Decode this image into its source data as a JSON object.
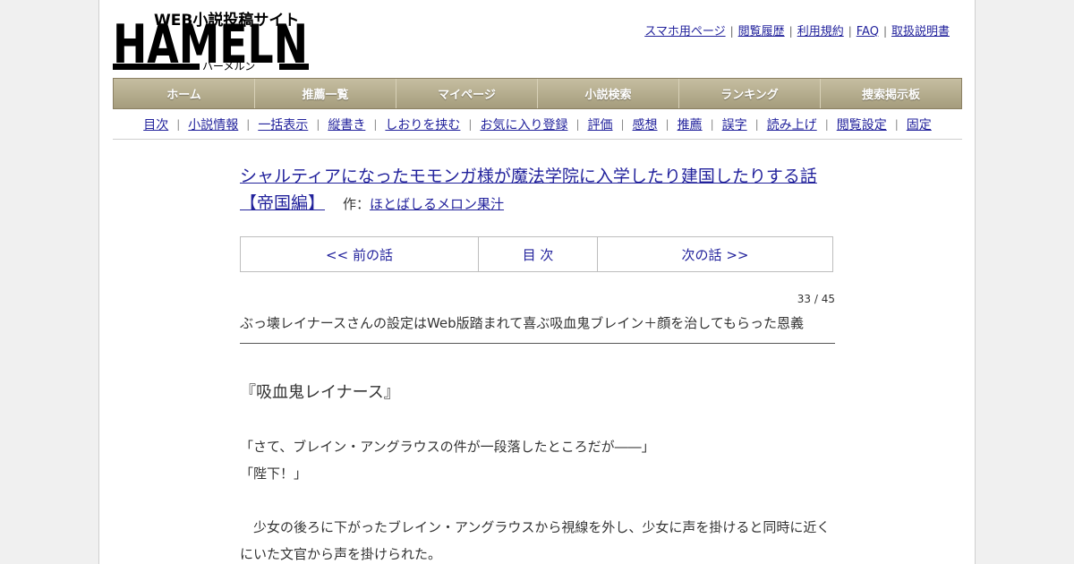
{
  "logo": {
    "tagline": "WEB小説投稿サイト",
    "wordmark": "HAMELN",
    "kana": "ハーメルン"
  },
  "top_links": [
    "スマホ用ページ",
    "閲覧履歴",
    "利用規約",
    "FAQ",
    "取扱説明書"
  ],
  "main_nav": [
    "ホーム",
    "推薦一覧",
    "マイページ",
    "小説検索",
    "ランキング",
    "捜索掲示板"
  ],
  "sub_nav": [
    "目次",
    "小説情報",
    "一括表示",
    "縦書き",
    "しおりを挟む",
    "お気に入り登録",
    "評価",
    "感想",
    "推薦",
    "誤字",
    "読み上げ",
    "閲覧設定",
    "固定"
  ],
  "novel": {
    "title": "シャルティアになったモモンガ様が魔法学院に入学したり建国したりする話【帝国編】",
    "author_prefix": "作：",
    "author": "ほとばしるメロン果汁"
  },
  "episode_nav": {
    "prev": "<< 前の話",
    "toc": "目 次",
    "next": "次の話 >>"
  },
  "progress": "33 / 45",
  "subtitle": "ぶっ壊レイナースさんの設定はWeb版踏まれて喜ぶ吸血鬼ブレイン＋顔を治してもらった恩義",
  "body": {
    "heading": "『吸血鬼レイナース』",
    "line1": "「さて、ブレイン・アングラウスの件が一段落したところだが――」",
    "line2": "「陛下！」",
    "line3": "　少女の後ろに下がったブレイン・アングラウスから視線を外し、少女に声を掛けると同時に近くにいた文官から声を掛けられた。"
  }
}
